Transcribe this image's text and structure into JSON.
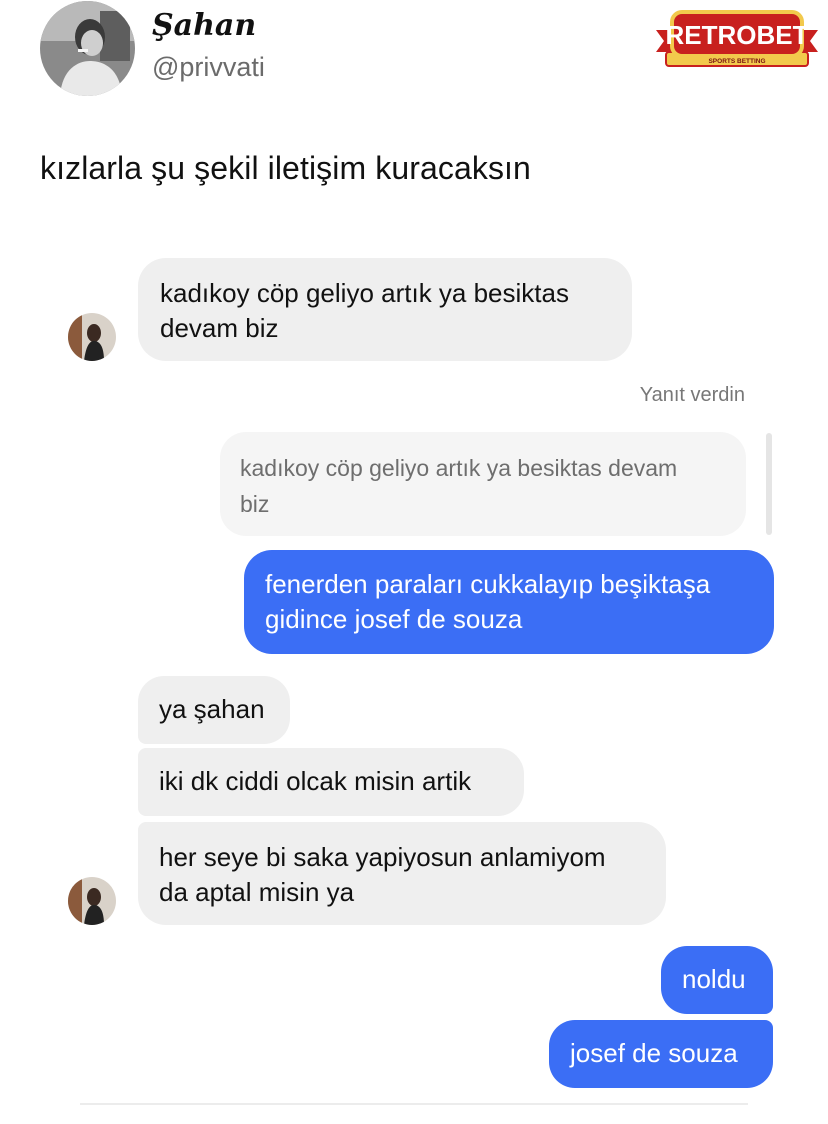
{
  "tweet": {
    "author_name": "Şahan",
    "handle": "@privvati",
    "text": "kızlarla şu şekil iletişim kuracaksın",
    "sponsor_logo": {
      "title": "RETROBET",
      "subtitle": "SPORTS BETTING",
      "colors": {
        "red": "#c8201e",
        "gold": "#f2c94c"
      }
    }
  },
  "chat": {
    "reply_label": "Yanıt verdin",
    "messages": [
      {
        "side": "in",
        "text_lines": [
          "kadıkoy cöp geliyo artık ya besiktas",
          "devam biz"
        ]
      },
      {
        "side": "quote",
        "text_lines": [
          "kadıkoy cöp geliyo artık ya besiktas devam",
          "biz"
        ]
      },
      {
        "side": "out",
        "text_lines": [
          "fenerden paraları cukkalayıp beşiktaşa",
          "gidince josef de souza"
        ]
      },
      {
        "side": "in",
        "text_lines": [
          "ya şahan"
        ]
      },
      {
        "side": "in",
        "text_lines": [
          "iki dk ciddi olcak misin artik"
        ]
      },
      {
        "side": "in",
        "text_lines": [
          "her seye bi saka yapiyosun anlamiyom",
          "da aptal misin ya"
        ]
      },
      {
        "side": "out",
        "text_lines": [
          "noldu"
        ]
      },
      {
        "side": "out",
        "text_lines": [
          "josef de souza"
        ]
      }
    ],
    "colors": {
      "incoming": "#efefef",
      "outgoing": "#3b6ef5"
    }
  }
}
